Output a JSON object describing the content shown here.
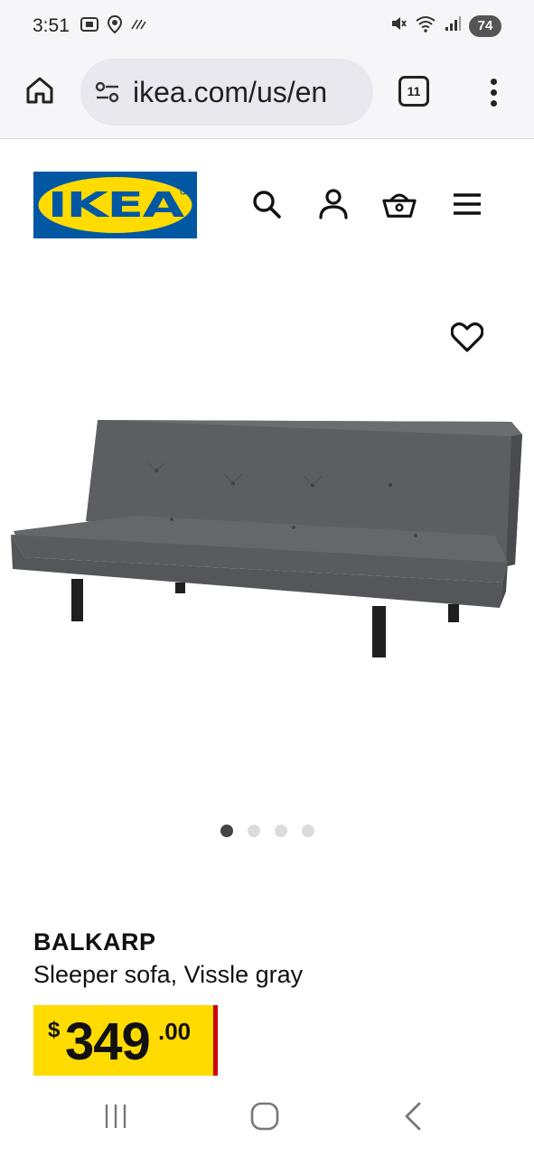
{
  "status_bar": {
    "time": "3:51",
    "battery": "74",
    "icons": [
      "screenshot-icon",
      "location-icon",
      "nfc-icon",
      "mute-icon",
      "wifi-icon",
      "signal-icon"
    ]
  },
  "browser": {
    "url": "ikea.com/us/en",
    "tab_count": "11"
  },
  "site": {
    "logo_text": "IKEA",
    "icons": [
      "search-icon",
      "account-icon",
      "basket-icon",
      "hamburger-menu-icon"
    ]
  },
  "product": {
    "name": "BALKARP",
    "description": "Sleeper sofa, Vissle gray",
    "price_currency": "$",
    "price_integer": "349",
    "price_decimal": ".00",
    "carousel_total": 4,
    "carousel_active": 1
  },
  "colors": {
    "ikea_blue": "#0058a3",
    "ikea_yellow": "#ffdb00",
    "price_accent_red": "#cc0008",
    "sofa_gray": "#5d5e62"
  }
}
